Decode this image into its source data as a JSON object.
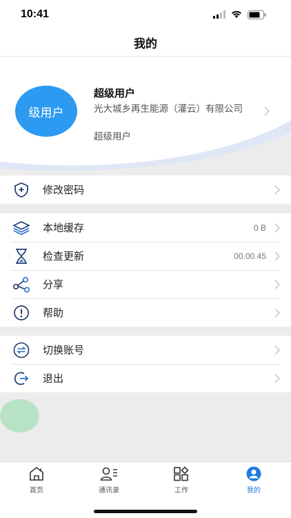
{
  "status": {
    "time": "10:41"
  },
  "header": {
    "title": "我的"
  },
  "profile": {
    "avatar_text": "级用户",
    "name": "超级用户",
    "organization": "光大城乡再生能源（灌云）有限公司",
    "role": "超级用户"
  },
  "groups": [
    {
      "items": [
        {
          "label": "修改密码",
          "icon": "shield-plus-icon"
        }
      ]
    },
    {
      "items": [
        {
          "label": "本地缓存",
          "icon": "layers-icon",
          "value": "0 B"
        },
        {
          "label": "检查更新",
          "icon": "hourglass-icon",
          "value": "00.00.45"
        },
        {
          "label": "分享",
          "icon": "share-icon"
        },
        {
          "label": "帮助",
          "icon": "alert-circle-icon"
        }
      ]
    },
    {
      "items": [
        {
          "label": "切换账号",
          "icon": "switch-arrows-icon"
        },
        {
          "label": "退出",
          "icon": "logout-icon"
        }
      ]
    }
  ],
  "tabbar": {
    "items": [
      {
        "label": "首页",
        "icon": "home-icon"
      },
      {
        "label": "通讯录",
        "icon": "contacts-icon"
      },
      {
        "label": "工作",
        "icon": "apps-grid-icon"
      },
      {
        "label": "我的",
        "icon": "profile-icon",
        "active": true
      }
    ]
  },
  "colors": {
    "accent": "#2d9af1",
    "active_tab": "#1f7be0",
    "icon_blue": "#2a6fc9",
    "wave": "#dfe6f6"
  }
}
